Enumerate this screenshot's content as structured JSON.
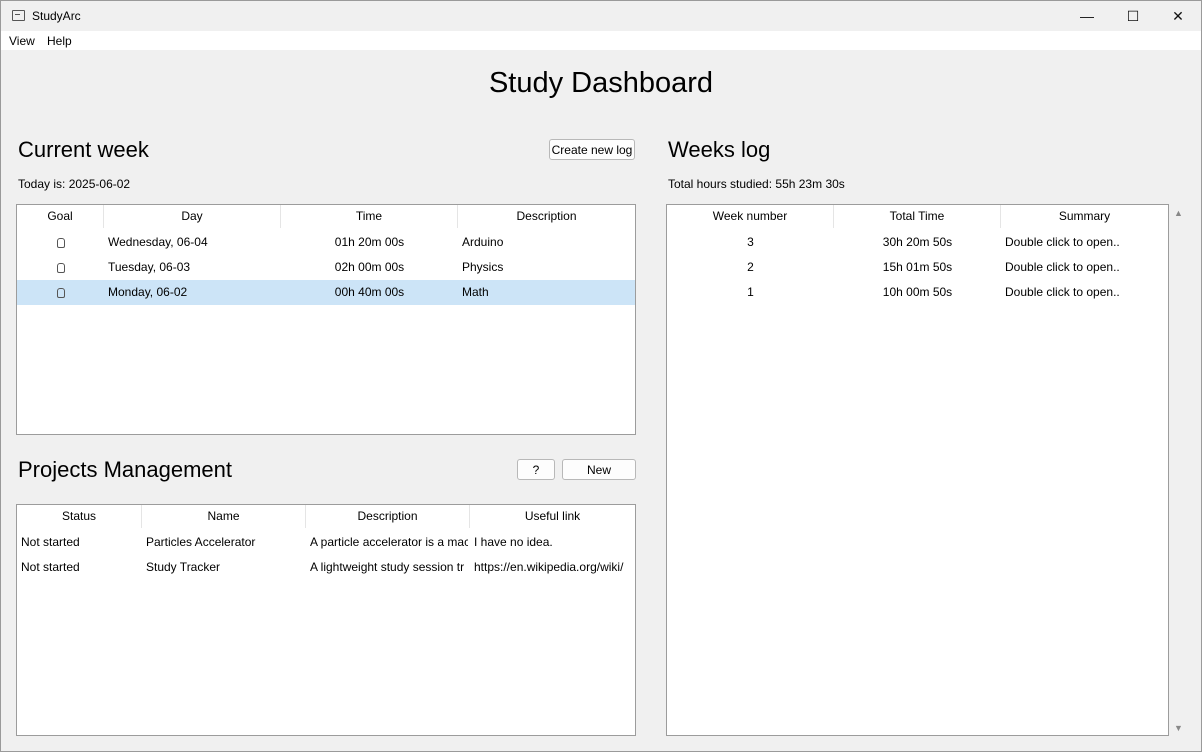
{
  "window": {
    "title": "StudyArc",
    "minimize": "—",
    "maximize": "☐",
    "close": "✕"
  },
  "menu": [
    "View",
    "Help"
  ],
  "dashboard_title": "Study Dashboard",
  "current_week": {
    "title": "Current week",
    "create_button": "Create new log",
    "today_label": "Today is:",
    "today_value": "2025-06-02",
    "columns": [
      "Goal",
      "Day",
      "Time",
      "Description"
    ],
    "rows": [
      {
        "goal_icon": "goal-icon",
        "day": "Wednesday, 06-04",
        "time": "01h 20m 00s",
        "description": "Arduino"
      },
      {
        "goal_icon": "goal-icon",
        "day": "Tuesday, 06-03",
        "time": "02h 00m 00s",
        "description": "Physics"
      },
      {
        "goal_icon": "goal-icon",
        "day": "Monday, 06-02",
        "time": "00h 40m 00s",
        "description": "Math",
        "selected": true
      }
    ]
  },
  "projects": {
    "title": "Projects Management",
    "help_button": "?",
    "new_button": "New",
    "columns": [
      "Status",
      "Name",
      "Description",
      "Useful link"
    ],
    "rows": [
      {
        "status": "Not started",
        "name": "Particles Accelerator",
        "description": "A particle accelerator is a mac",
        "link": "I have no idea."
      },
      {
        "status": "Not started",
        "name": "Study Tracker",
        "description": "A lightweight study session tr",
        "link": "https://en.wikipedia.org/wiki/"
      }
    ]
  },
  "weeks_log": {
    "title": "Weeks log",
    "total_label": "Total hours studied:",
    "total_value": "55h 23m 30s",
    "columns": [
      "Week number",
      "Total Time",
      "Summary"
    ],
    "rows": [
      {
        "week": "3",
        "total": "30h 20m 50s",
        "summary": "Double click to open.."
      },
      {
        "week": "2",
        "total": "15h 01m 50s",
        "summary": "Double click to open.."
      },
      {
        "week": "1",
        "total": "10h 00m 50s",
        "summary": "Double click to open.."
      }
    ]
  }
}
